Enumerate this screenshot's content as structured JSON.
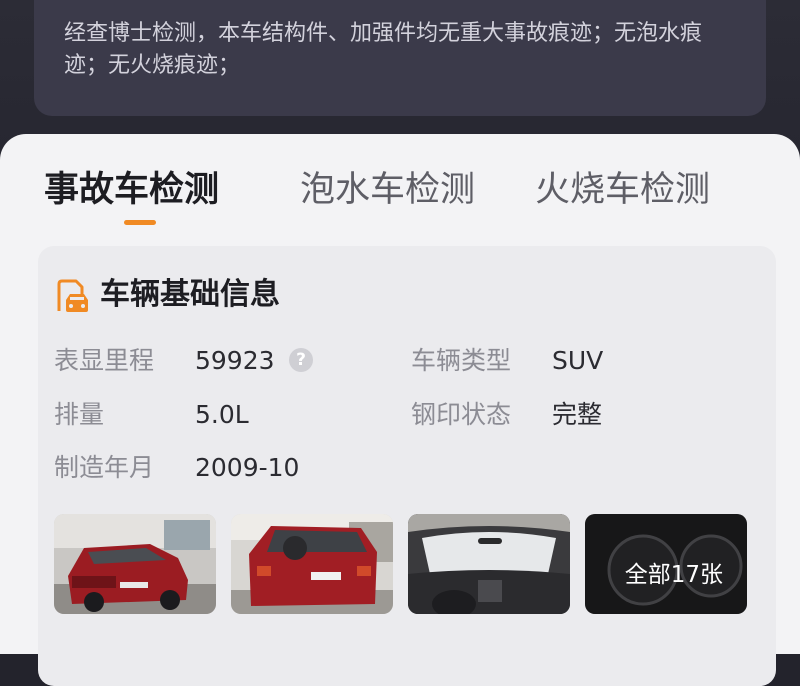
{
  "theme": {
    "accent": "#f08a24",
    "card_bg": "#ebebee",
    "sheet_bg": "#f3f3f5",
    "header_bg": "#23232c"
  },
  "summary": {
    "text": "经查博士检测，本车结构件、加强件均无重大事故痕迹；无泡水痕迹；无火烧痕迹；"
  },
  "tabs": [
    {
      "label": "事故车检测",
      "active": true
    },
    {
      "label": "泡水车检测",
      "active": false
    },
    {
      "label": "火烧车检测",
      "active": false
    }
  ],
  "basic_info": {
    "icon": "car-document-icon",
    "title": "车辆基础信息",
    "mileage_label": "表显里程",
    "mileage_value": "59923",
    "help_icon_glyph": "?",
    "type_label": "车辆类型",
    "type_value": "SUV",
    "displacement_label": "排量",
    "displacement_value": "5.0L",
    "steel_stamp_label": "钢印状态",
    "steel_stamp_value": "完整",
    "manufacture_label": "制造年月",
    "manufacture_value": "2009-10"
  },
  "photos": {
    "items": [
      {
        "icon": "car-front-photo"
      },
      {
        "icon": "car-rear-photo"
      },
      {
        "icon": "car-interior-photo"
      },
      {
        "icon": "car-dashboard-photo"
      }
    ],
    "view_all_label": "全部17张"
  }
}
